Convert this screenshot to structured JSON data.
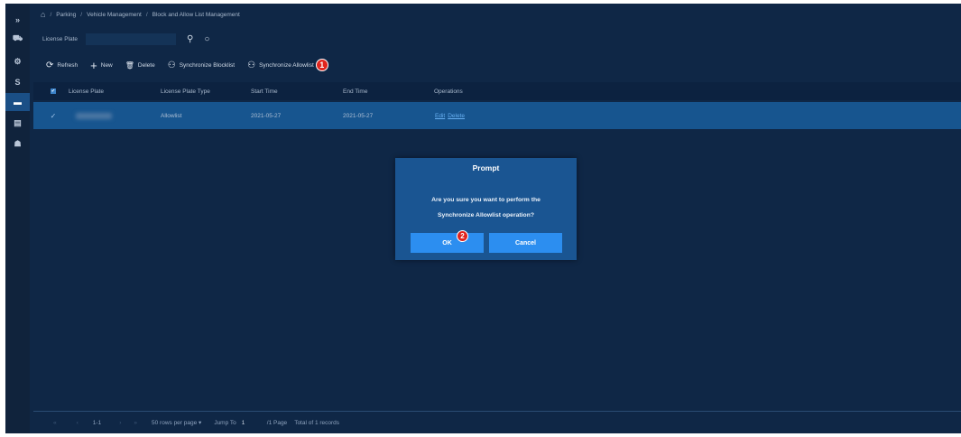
{
  "sidebar": {
    "items": [
      {
        "icon": "expand-icon",
        "glyph": "»",
        "active": false
      },
      {
        "icon": "car-icon",
        "glyph": "⛟",
        "active": false
      },
      {
        "icon": "settings-icon",
        "glyph": "⚙",
        "active": false
      },
      {
        "icon": "dollar-icon",
        "glyph": "S",
        "active": false
      },
      {
        "icon": "vehicle-icon",
        "glyph": "▬",
        "active": true
      },
      {
        "icon": "report-icon",
        "glyph": "▤",
        "active": false
      },
      {
        "icon": "user-group-icon",
        "glyph": "☗",
        "active": false
      }
    ]
  },
  "breadcrumb": {
    "home_glyph": "⌂",
    "sep": "/",
    "items": [
      "Parking",
      "Vehicle Management",
      "Block and Allow List Management"
    ]
  },
  "search": {
    "label": "License Plate",
    "value": "",
    "placeholder": "",
    "search_glyph": "⚲",
    "reset_glyph": "○"
  },
  "toolbar": {
    "refresh": {
      "glyph": "⟳",
      "label": "Refresh"
    },
    "new": {
      "glyph": "+",
      "label": "New"
    },
    "delete": {
      "glyph": "🗑",
      "label": "Delete"
    },
    "sync_blocklist": {
      "glyph": "⚇",
      "label": "Synchronize Blocklist"
    },
    "sync_allowlist": {
      "glyph": "⚇",
      "label": "Synchronize Allowlist"
    },
    "step_badge": "1"
  },
  "table": {
    "headers": [
      "License Plate",
      "License Plate Type",
      "Start Time",
      "End Time",
      "Operations"
    ],
    "rows": [
      {
        "license_plate": "",
        "type": "Allowlist",
        "start": "2021-05-27",
        "end": "2021-05-27",
        "edit": "Edit",
        "delete": "Delete"
      }
    ]
  },
  "pagination": {
    "first": "«",
    "prev": "‹",
    "range": "1-1",
    "next": "›",
    "last": "»",
    "page_size": "50 rows per page",
    "dropdown_glyph": "▾",
    "jump_label": "Jump To",
    "jump_value": "1",
    "pages": "/1 Page",
    "total": "Total of 1 records"
  },
  "dialog": {
    "title": "Prompt",
    "message_line1": "Are you sure you want to perform the",
    "message_line2": "Synchronize Allowlist operation?",
    "ok": "OK",
    "cancel": "Cancel",
    "step_badge": "2"
  },
  "colors": {
    "background": "#0f2746",
    "selected_row": "#17558f",
    "dialog": "#1a5592",
    "button": "#2c8ef0",
    "badge": "#e0251e"
  }
}
